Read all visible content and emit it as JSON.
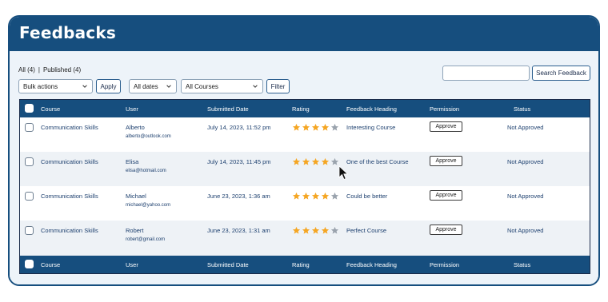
{
  "page": {
    "title": "Feedbacks"
  },
  "filters": {
    "all_label": "All (4)",
    "separator": "|",
    "published_label": "Published (4)",
    "bulk_actions": "Bulk actions",
    "apply": "Apply",
    "dates": "All dates",
    "courses": "All Courses",
    "filter": "Filter"
  },
  "search": {
    "placeholder": "",
    "button": "Search Feedback"
  },
  "columns": {
    "course": "Course",
    "user": "User",
    "submitted": "Submitted Date",
    "rating": "Rating",
    "heading": "Feedback Heading",
    "permission": "Permission",
    "status": "Status"
  },
  "rows": [
    {
      "course": "Communication Skills",
      "user": "Alberto",
      "email": "alberto@outlook.com",
      "date": "July 14, 2023, 11:52 pm",
      "rating": 4,
      "heading": "Interesting Course",
      "permission": "Approve",
      "status": "Not Approved"
    },
    {
      "course": "Communication Skills",
      "user": "Elisa",
      "email": "elisa@hotmail.com",
      "date": "July 14, 2023, 11:45 pm",
      "rating": 4,
      "heading": "One of the best Course",
      "permission": "Approve",
      "status": "Not Approved"
    },
    {
      "course": "Communication Skills",
      "user": "Michael",
      "email": "michael@yahoo.com",
      "date": "June 23, 2023, 1:36 am",
      "rating": 4,
      "heading": "Could be better",
      "permission": "Approve",
      "status": "Not Approved"
    },
    {
      "course": "Communication Skills",
      "user": "Robert",
      "email": "robert@gmail.com",
      "date": "June 23, 2023, 1:31 am",
      "rating": 4,
      "heading": "Perfect Course",
      "permission": "Approve",
      "status": "Not Approved"
    }
  ],
  "colors": {
    "primary": "#164e7e",
    "star_filled": "#f5a623",
    "star_empty": "#9aa3ad"
  },
  "icons": {
    "select_arrow": "chevron-down-icon",
    "star": "star-icon",
    "cursor": "mouse-pointer-icon"
  }
}
